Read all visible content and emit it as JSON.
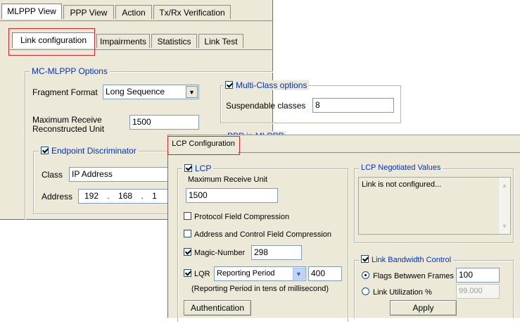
{
  "back_window": {
    "main_tabs": [
      "MLPPP View",
      "PPP View",
      "Action",
      "Tx/Rx Verification"
    ],
    "sub_tabs": [
      "Link configuration",
      "Impairments",
      "Statistics",
      "Link Test"
    ],
    "mc_group": {
      "title": "MC-MLPPP Options",
      "fragment_format_label": "Fragment Format",
      "fragment_format_value": "Long Sequence",
      "mrru_label_line1": "Maximum Receive",
      "mrru_label_line2": "Reconstructed Unit",
      "mrru_value": "1500"
    },
    "multiclass": {
      "title": "Multi-Class options",
      "checked": true,
      "suspendable_label": "Suspendable classes",
      "suspendable_value": "8"
    },
    "ppp_in_mlppp_title": "PPP in MLPPP",
    "endpoint": {
      "title": "Endpoint Discriminator",
      "checked": true,
      "class_label": "Class",
      "class_value": "IP Address",
      "address_label": "Address",
      "address_octets": [
        "192",
        "168",
        "1"
      ]
    }
  },
  "front_window": {
    "tab": "LCP Configuration",
    "lcp": {
      "title": "LCP",
      "checked": true,
      "mru_label": "Maximum Receive Unit",
      "mru_value": "1500",
      "protocol_field_compression": "Protocol Field Compression",
      "address_control_compression": "Address and Control Field Compression",
      "magic_number_label": "Magic-Number",
      "magic_number_value": "298",
      "lqr_label": "LQR",
      "lqr_mode": "Reporting Period",
      "lqr_value": "400",
      "lqr_note": "(Reporting Period in tens of millisecond)",
      "authentication_button": "Authentication"
    },
    "negotiated": {
      "title": "LCP Negotiated Values",
      "text": "Link is not configured..."
    },
    "bandwidth": {
      "title": "Link Bandwidth Control",
      "checked": true,
      "flags_label": "Flags Betwwen Frames",
      "flags_value": "100",
      "utilization_label": "Link Utilization %",
      "utilization_value": "99.000",
      "apply_button": "Apply"
    }
  },
  "colors": {
    "panel": "#ece9d8",
    "group_title": "#0033cc",
    "highlight": "#e12222"
  }
}
